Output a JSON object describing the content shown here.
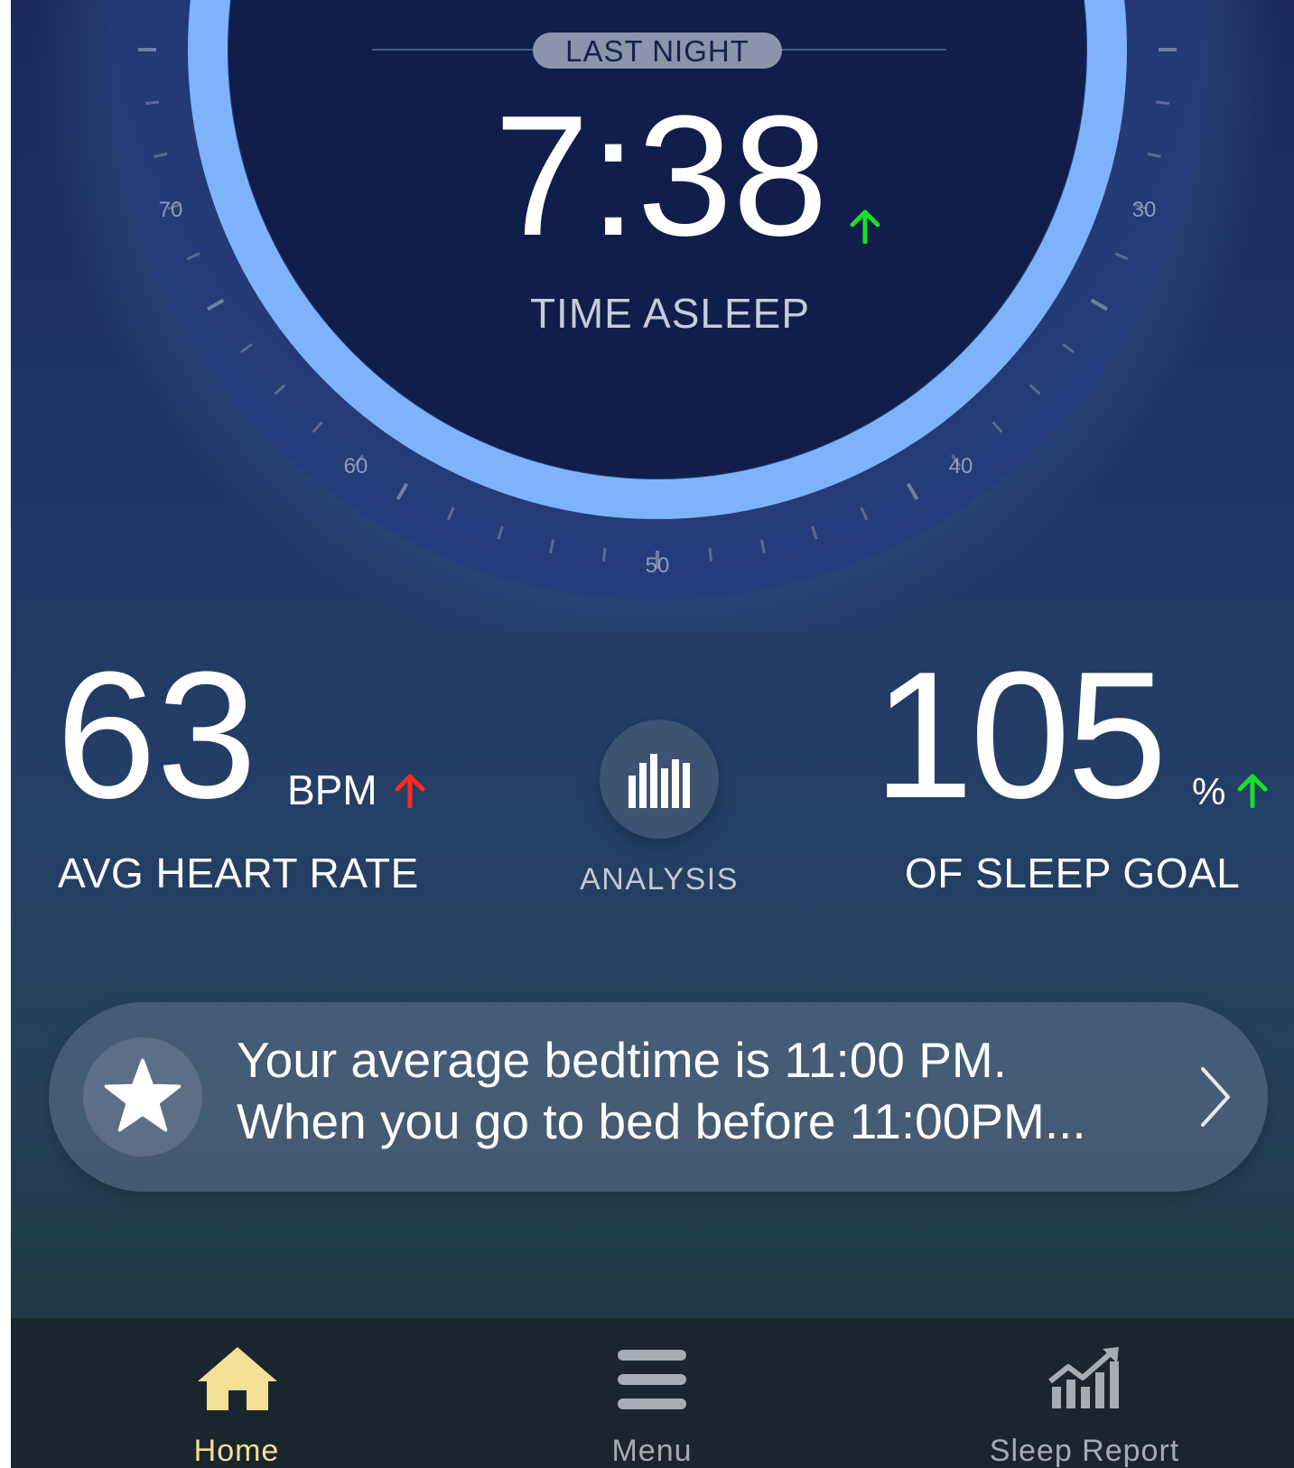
{
  "dial": {
    "badge": "LAST NIGHT",
    "time_asleep": "7:38",
    "time_label": "TIME ASLEEP",
    "scale_labels": [
      "70",
      "30",
      "60",
      "40",
      "50"
    ],
    "ring_color": "#7fb3f9",
    "trend": "up"
  },
  "stats": {
    "heart_rate": {
      "value": "63",
      "unit": "BPM",
      "label": "AVG HEART RATE",
      "trend": "up",
      "trend_color": "#ff2a1f"
    },
    "analysis": {
      "label": "ANALYSIS",
      "icon": "bar-chart-icon"
    },
    "sleep_goal": {
      "value": "105",
      "unit": "%",
      "label": "OF SLEEP GOAL",
      "trend": "up",
      "trend_color": "#17e02a"
    }
  },
  "insight": {
    "icon": "star-icon",
    "line1": "Your average bedtime is 11:00 PM.",
    "line2": "When you go to bed before 11:00PM...",
    "action_icon": "chevron-right-icon"
  },
  "tabbar": {
    "active_color": "#f3df95",
    "inactive_color": "#a5acb4",
    "tabs": [
      {
        "label": "Home",
        "icon": "home-icon",
        "active": true
      },
      {
        "label": "Menu",
        "icon": "menu-icon",
        "active": false
      },
      {
        "label": "Sleep Report",
        "icon": "sleep-report-icon",
        "active": false
      }
    ]
  }
}
